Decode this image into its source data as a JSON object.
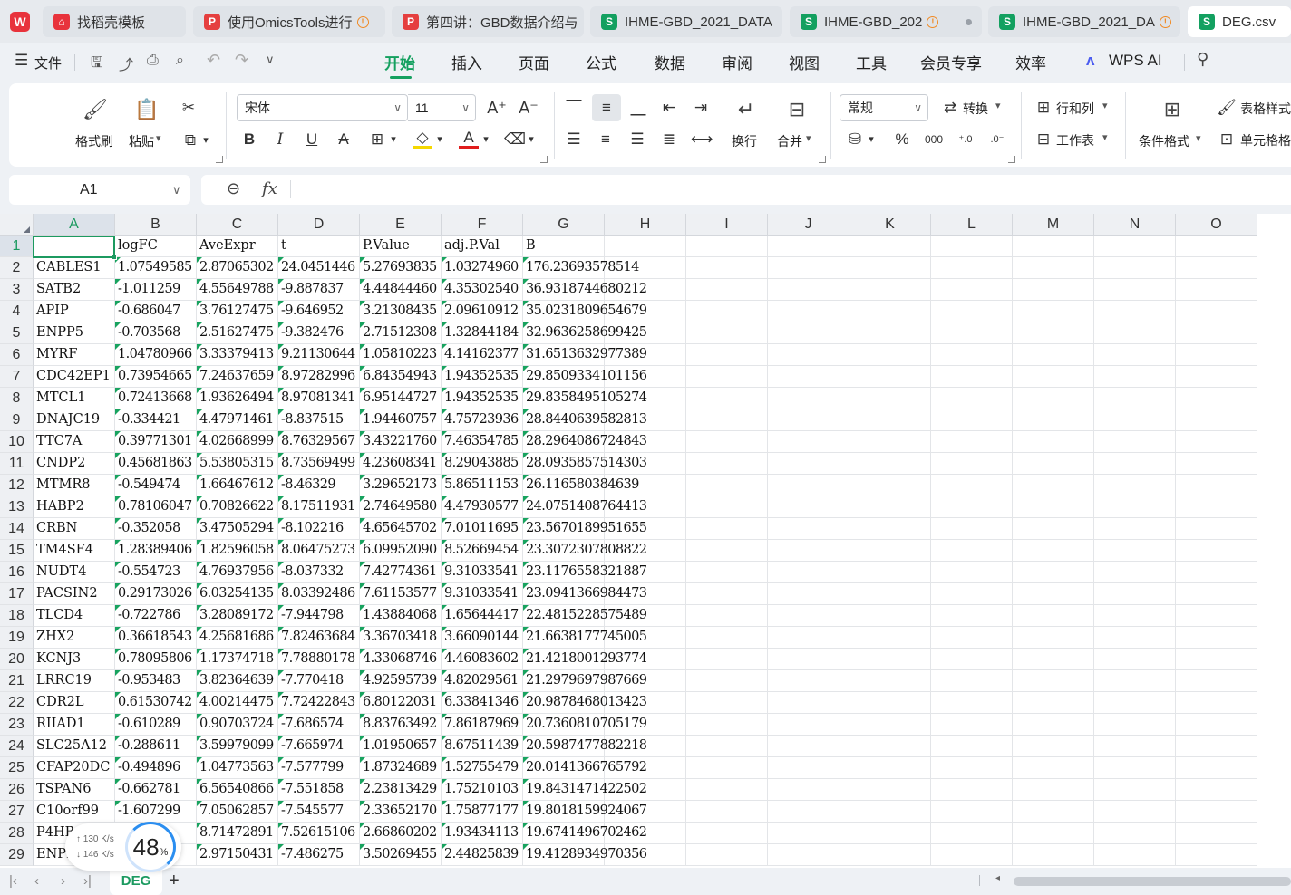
{
  "tabs": [
    {
      "label": "找稻壳模板",
      "icon": "daoke-icon",
      "active": false,
      "warning": false
    },
    {
      "label": "使用OmicsTools进行",
      "icon": "pdf-icon",
      "active": false,
      "warning": true
    },
    {
      "label": "第四讲：GBD数据介绍与",
      "icon": "pdf-icon",
      "active": false,
      "warning": false
    },
    {
      "label": "IHME-GBD_2021_DATA",
      "icon": "sheet-icon",
      "active": false,
      "warning": false
    },
    {
      "label": "IHME-GBD_202",
      "icon": "sheet-icon",
      "active": false,
      "warning": true
    },
    {
      "label": "IHME-GBD_2021_DA",
      "icon": "sheet-icon",
      "active": false,
      "warning": true
    },
    {
      "label": "DEG.csv",
      "icon": "sheet-icon",
      "active": true,
      "warning": false
    }
  ],
  "menu": {
    "file": "文件",
    "items": [
      "开始",
      "插入",
      "页面",
      "公式",
      "数据",
      "审阅",
      "视图",
      "工具",
      "会员专享",
      "效率"
    ],
    "active": "开始",
    "wps_ai": "WPS AI"
  },
  "ribbon": {
    "format_painter": "格式刷",
    "paste": "粘贴",
    "font_name": "宋体",
    "font_size": "11",
    "wrap": "换行",
    "merge": "合并",
    "number_format": "常规",
    "convert": "转换",
    "row_col": "行和列",
    "worksheet": "工作表",
    "cond_format": "条件格式",
    "table_style": "表格样式",
    "cell_format": "单元格格"
  },
  "formula_bar": {
    "name_box": "A1",
    "fx": "fx",
    "value": ""
  },
  "columns": [
    "A",
    "B",
    "C",
    "D",
    "E",
    "F",
    "G",
    "H",
    "I",
    "J",
    "K",
    "L",
    "M",
    "N",
    "O"
  ],
  "selected": {
    "col": "A",
    "row": 1
  },
  "table": {
    "header": [
      "",
      "logFC",
      "AveExpr",
      "t",
      "P.Value",
      "adj.P.Val",
      "B"
    ],
    "rows": [
      [
        "CABLES1",
        "1.07549585",
        "2.87065302",
        "24.0451446",
        "5.27693835",
        "1.03274960",
        "176.23693578514"
      ],
      [
        "SATB2",
        "-1.011259",
        "4.55649788",
        "-9.887837",
        "4.44844460",
        "4.35302540",
        "36.9318744680212"
      ],
      [
        "APIP",
        "-0.686047",
        "3.76127475",
        "-9.646952",
        "3.21308435",
        "2.09610912",
        "35.0231809654679"
      ],
      [
        "ENPP5",
        "-0.703568",
        "2.51627475",
        "-9.382476",
        "2.71512308",
        "1.32844184",
        "32.9636258699425"
      ],
      [
        "MYRF",
        "1.04780966",
        "3.33379413",
        "9.21130644",
        "1.05810223",
        "4.14162377",
        "31.6513632977389"
      ],
      [
        "CDC42EP1",
        "0.73954665",
        "7.24637659",
        "8.97282996",
        "6.84354943",
        "1.94352535",
        "29.8509334101156"
      ],
      [
        "MTCL1",
        "0.72413668",
        "1.93626494",
        "8.97081341",
        "6.95144727",
        "1.94352535",
        "29.8358495105274"
      ],
      [
        "DNAJC19",
        "-0.334421",
        "4.47971461",
        "-8.837515",
        "1.94460757",
        "4.75723936",
        "28.8440639582813"
      ],
      [
        "TTC7A",
        "0.39771301",
        "4.02668999",
        "8.76329567",
        "3.43221760",
        "7.46354785",
        "28.2964086724843"
      ],
      [
        "CNDP2",
        "0.45681863",
        "5.53805315",
        "8.73569499",
        "4.23608341",
        "8.29043885",
        "28.0935857514303"
      ],
      [
        "MTMR8",
        "-0.549474",
        "1.66467612",
        "-8.46329",
        "3.29652173",
        "5.86511153",
        "26.116580384639"
      ],
      [
        "HABP2",
        "0.78106047",
        "0.70826622",
        "8.17511931",
        "2.74649580",
        "4.47930577",
        "24.0751408764413"
      ],
      [
        "CRBN",
        "-0.352058",
        "3.47505294",
        "-8.102216",
        "4.65645702",
        "7.01011695",
        "23.5670189951655"
      ],
      [
        "TM4SF4",
        "1.28389406",
        "1.82596058",
        "8.06475273",
        "6.09952090",
        "8.52669454",
        "23.3072307808822"
      ],
      [
        "NUDT4",
        "-0.554723",
        "4.76937956",
        "-8.037332",
        "7.42774361",
        "9.31033541",
        "23.1176558321887"
      ],
      [
        "PACSIN2",
        "0.29173026",
        "6.03254135",
        "8.03392486",
        "7.61153577",
        "9.31033541",
        "23.0941366984473"
      ],
      [
        "TLCD4",
        "-0.722786",
        "3.28089172",
        "-7.944798",
        "1.43884068",
        "1.65644417",
        "22.4815228575489"
      ],
      [
        "ZHX2",
        "0.36618543",
        "4.25681686",
        "7.82463684",
        "3.36703418",
        "3.66090144",
        "21.6638177745005"
      ],
      [
        "KCNJ3",
        "0.78095806",
        "1.17374718",
        "7.78880178",
        "4.33068746",
        "4.46083602",
        "21.4218001293774"
      ],
      [
        "LRRC19",
        "-0.953483",
        "3.82364639",
        "-7.770418",
        "4.92595739",
        "4.82029561",
        "21.2979697987669"
      ],
      [
        "CDR2L",
        "0.61530742",
        "4.00214475",
        "7.72422843",
        "6.80122031",
        "6.33841346",
        "20.9878468013423"
      ],
      [
        "RIIAD1",
        "-0.610289",
        "0.90703724",
        "-7.686574",
        "8.83763492",
        "7.86187969",
        "20.7360810705179"
      ],
      [
        "SLC25A12",
        "-0.288611",
        "3.59979099",
        "-7.665974",
        "1.01950657",
        "8.67511439",
        "20.5987477882218"
      ],
      [
        "CFAP20DC",
        "-0.494896",
        "1.04773563",
        "-7.577799",
        "1.87324689",
        "1.52755479",
        "20.0141366765792"
      ],
      [
        "TSPAN6",
        "-0.662781",
        "6.56540866",
        "-7.551858",
        "2.23813429",
        "1.75210103",
        "19.8431471422502"
      ],
      [
        "C10orf99",
        "-1.607299",
        "7.05062857",
        "-7.545577",
        "2.33652170",
        "1.75877177",
        "19.8018159924067"
      ],
      [
        "P4HB",
        "0.2813",
        "8.71472891",
        "7.52615106",
        "2.66860202",
        "1.93434113",
        "19.6741496702462"
      ],
      [
        "ENPP1",
        "-0.29121",
        "2.97150431",
        "-7.486275",
        "3.50269455",
        "2.44825839",
        "19.4128934970356"
      ]
    ]
  },
  "sheet_tab": "DEG",
  "overlay": {
    "up": "↑ 130 K/s",
    "down": "↓ 146 K/s",
    "percent": "48",
    "unit": "%"
  },
  "colors": {
    "accent": "#14a05f",
    "triangle": "#18a35f"
  }
}
